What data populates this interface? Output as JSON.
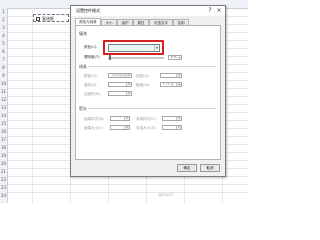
{
  "sheet": {
    "row_numbers": [
      "1",
      "2",
      "3",
      "4",
      "5",
      "6",
      "7",
      "8",
      "9",
      "10",
      "11",
      "12",
      "13",
      "14",
      "15",
      "16",
      "17",
      "18",
      "19",
      "20",
      "21",
      "22",
      "23",
      "24"
    ]
  },
  "checkbox_control": {
    "label": "复选框"
  },
  "dialog": {
    "title": "设置控件格式",
    "help_glyph": "?",
    "close_glyph": "×",
    "tabs": [
      "颜色与线条",
      "大小",
      "保护",
      "属性",
      "可选文字",
      "控制"
    ],
    "active_tab": "颜色与线条",
    "fill_section": {
      "title": "填充",
      "color_label": "颜色(C):",
      "transparency_label": "透明度(T):",
      "transparency_value": "0 %",
      "fill_color": "#e8f6f6"
    },
    "line_section": {
      "title": "线条",
      "color_label": "颜色(O):",
      "color_value": "无线条颜色",
      "dash_label": "虚线(D):",
      "style_label": "线型(S):",
      "weight_label": "粗细(W):",
      "weight_value": "0.75 磅",
      "connector_label": "连接符(N):"
    },
    "arrows_section": {
      "title": "箭头",
      "begin_style_label": "始端样式(B):",
      "end_style_label": "末端样式(E):",
      "begin_size_label": "始端大小(I):",
      "end_size_label": "末端大小(Z):"
    },
    "ok_label": "确定",
    "cancel_label": "取消",
    "highlight_color": "#d61f1f"
  },
  "watermark": "@Excel"
}
